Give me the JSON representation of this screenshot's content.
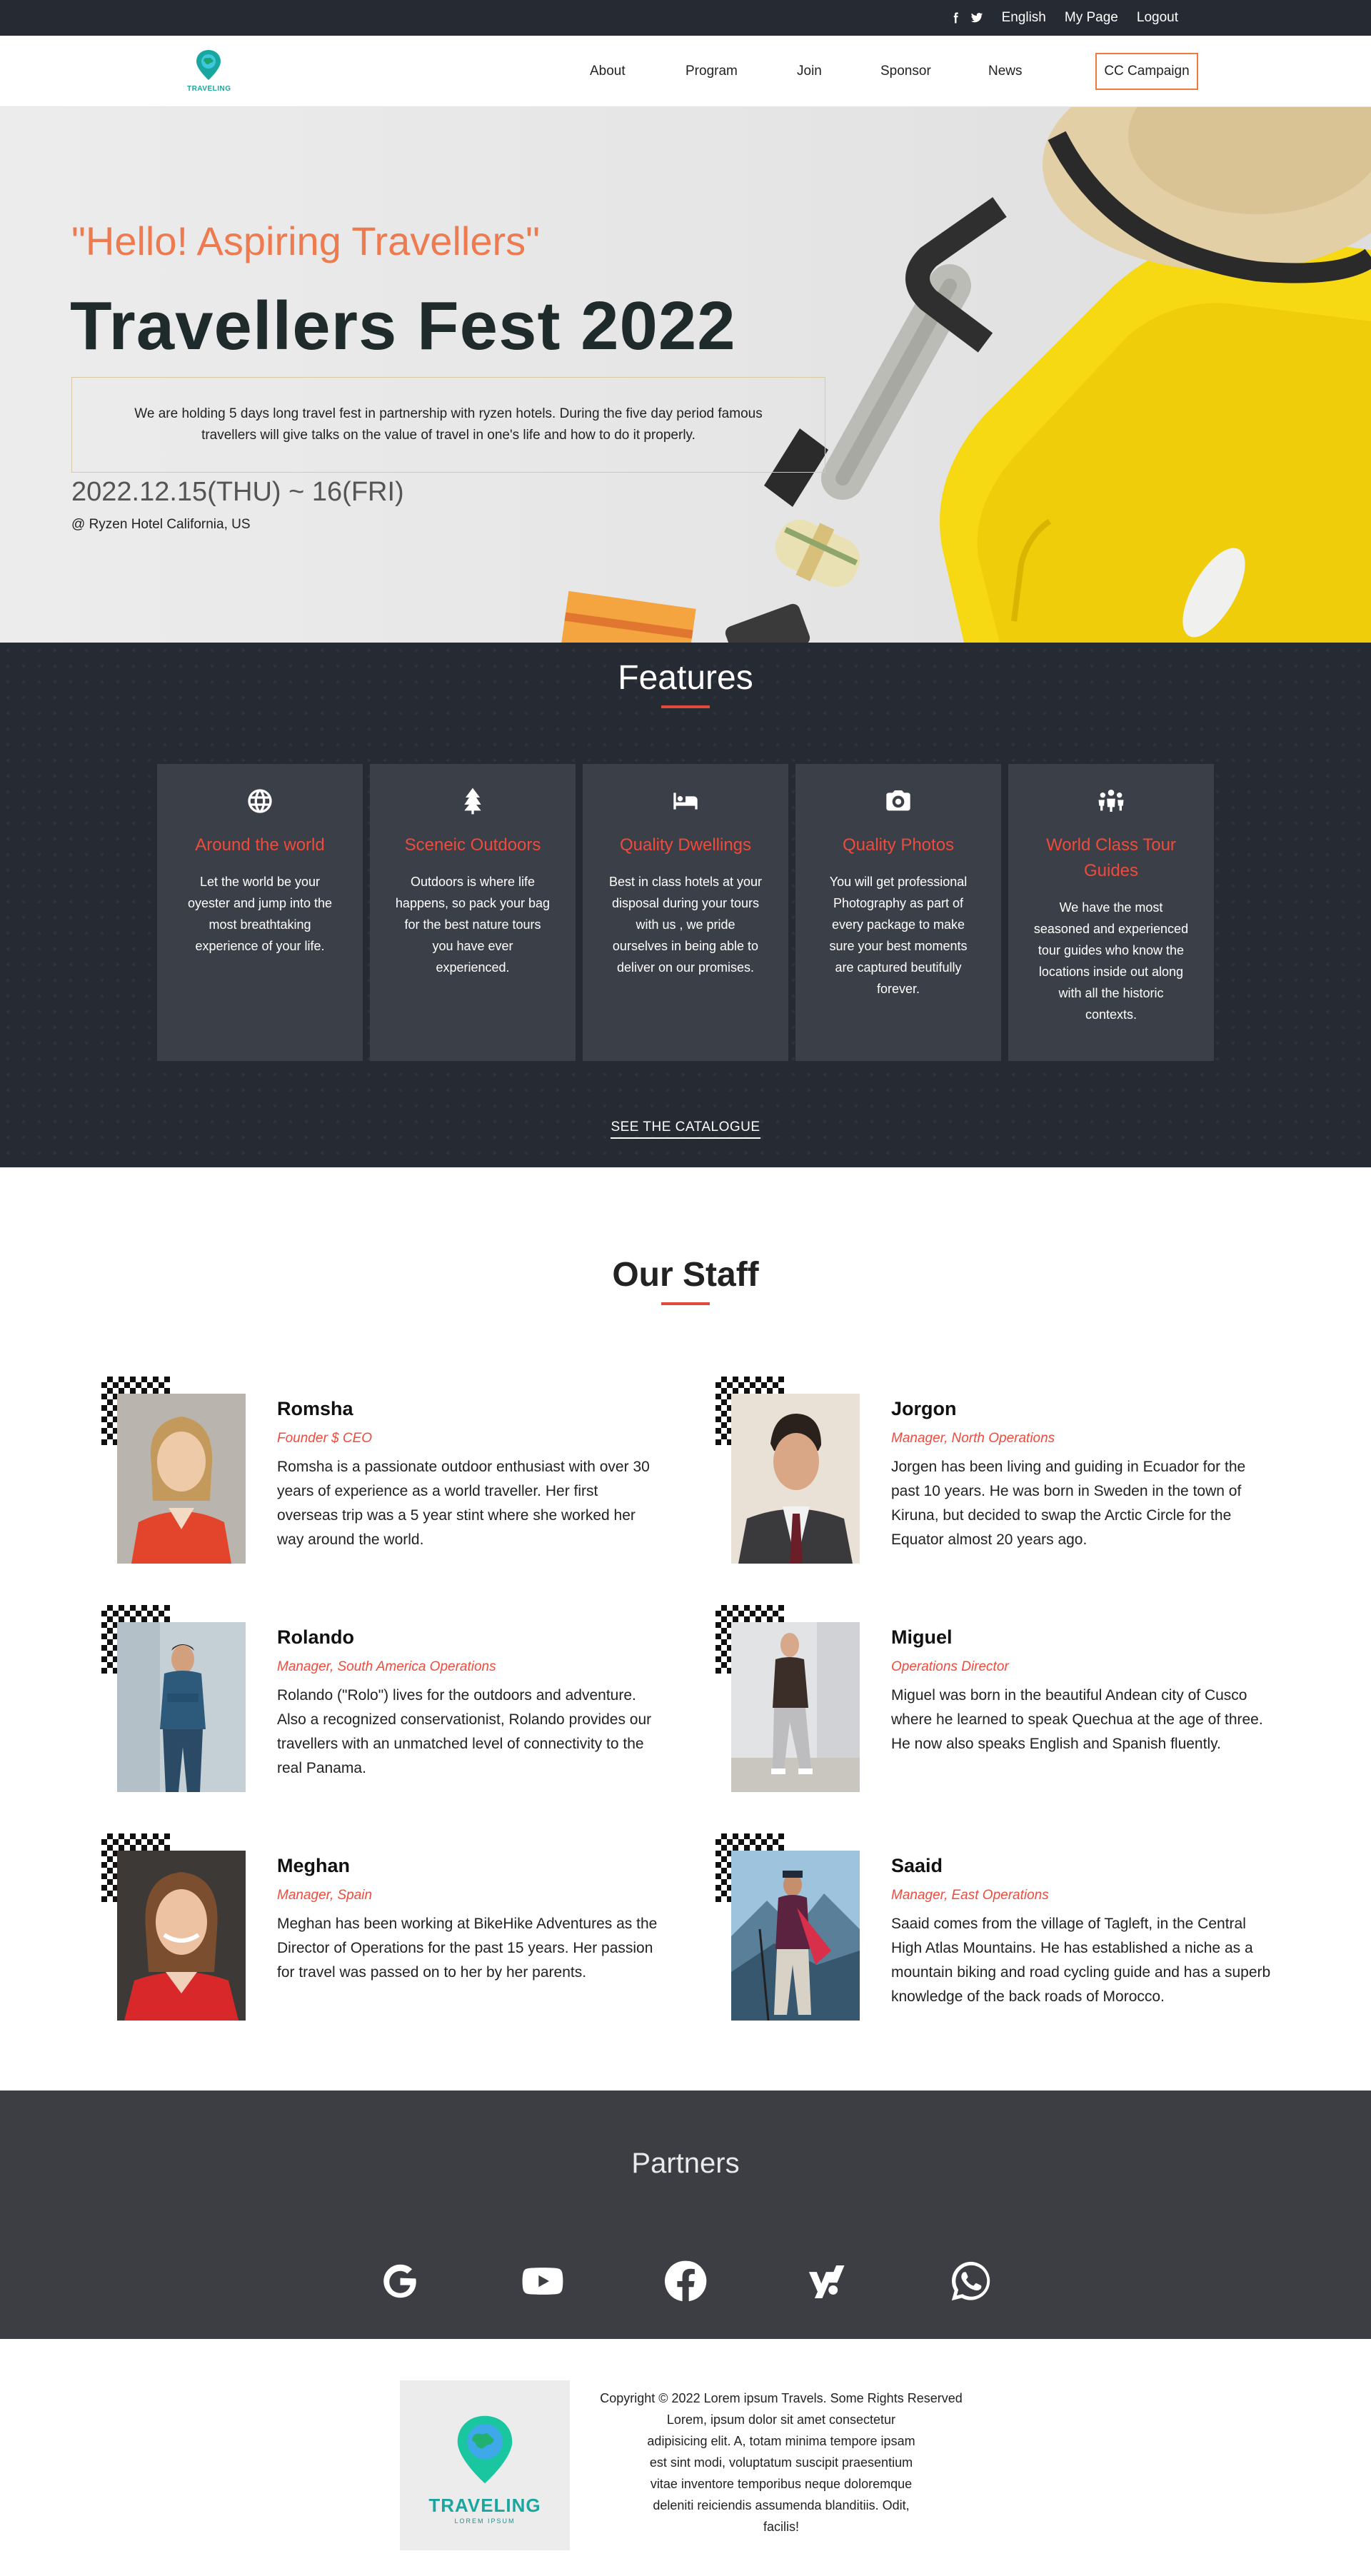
{
  "topbar": {
    "social_icons": [
      "facebook-icon",
      "twitter-icon"
    ],
    "language": "English",
    "my_page": "My Page",
    "logout": "Logout"
  },
  "nav": {
    "logo_word": "TRAVELING",
    "items": [
      "About",
      "Program",
      "Join",
      "Sponsor",
      "News"
    ],
    "cta": "CC Campaign"
  },
  "hero": {
    "subtitle": "\"Hello! Aspiring Travellers\"",
    "title": "Travellers Fest 2022",
    "description": "We are holding 5 days long travel fest in partnership with ryzen hotels. During the five day period famous travellers will give talks on the value of travel in one's life and how to do it properly.",
    "date": "2022.12.15(THU) ~ 16(FRI)",
    "venue": "@ Ryzen Hotel California, US"
  },
  "features": {
    "title": "Features",
    "cards": [
      {
        "icon": "globe-icon",
        "title": "Around the world",
        "text": "Let the world be your oyester and jump into the most breathtaking experience of your life."
      },
      {
        "icon": "tree-icon",
        "title": "Sceneic Outdoors",
        "text": "Outdoors is where life happens, so pack your bag for the best nature tours you have ever experienced."
      },
      {
        "icon": "bed-icon",
        "title": "Quality Dwellings",
        "text": "Best in class hotels at your disposal during your tours with us , we pride ourselves in being able to deliver on our promises."
      },
      {
        "icon": "camera-icon",
        "title": "Quality Photos",
        "text": "You will get professional Photography as part of every package to make sure your best moments are captured beutifully forever."
      },
      {
        "icon": "people-icon",
        "title": "World Class Tour Guides",
        "text": "We have the most seasoned and experienced tour guides who know the locations inside out along with all the historic contexts."
      }
    ],
    "catalogue_link": "SEE THE CATALOGUE"
  },
  "staff": {
    "title": "Our Staff",
    "members": [
      {
        "name": "Romsha",
        "role": "Founder $ CEO",
        "bio": "Romsha is a passionate outdoor enthusiast with over 30 years of experience as a world traveller. Her first overseas trip was a 5 year stint where she worked her way around the world."
      },
      {
        "name": "Jorgon",
        "role": "Manager, North Operations",
        "bio": "Jorgen has been living and guiding in Ecuador for the past 10 years. He was born in Sweden in the town of Kiruna, but decided to swap the Arctic Circle for the Equator almost 20 years ago."
      },
      {
        "name": "Rolando",
        "role": "Manager, South America Operations",
        "bio": "Rolando (\"Rolo\") lives for the outdoors and adventure. Also a recognized conservationist, Rolando provides our travellers with an unmatched level of connectivity to the real Panama."
      },
      {
        "name": "Miguel",
        "role": "Operations Director",
        "bio": "Miguel was born in the beautiful Andean city of Cusco where he learned to speak Quechua at the age of three. He now also speaks English and Spanish fluently."
      },
      {
        "name": "Meghan",
        "role": "Manager, Spain",
        "bio": "Meghan has been working at BikeHike Adventures as the Director of Operations for the past 15 years. Her passion for travel was passed on to her by her parents."
      },
      {
        "name": "Saaid",
        "role": "Manager, East Operations",
        "bio": "Saaid comes from the village of Tagleft, in the Central High Atlas Mountains. He has established a niche as a mountain biking and road cycling guide and has a superb knowledge of the back roads of Morocco."
      }
    ]
  },
  "partners": {
    "title": "Partners",
    "logos": [
      "google-icon",
      "youtube-icon",
      "facebook-icon",
      "yahoo-icon",
      "whatsapp-icon"
    ]
  },
  "footer": {
    "logo_word": "TRAVELING",
    "logo_tagline": "LOREM IPSUM",
    "copyright": "Copyright © 2022 Lorem ipsum Travels. Some Rights Reserved",
    "lorem": "Lorem, ipsum dolor sit amet consectetur adipisicing elit. A, totam minima tempore ipsam est sint modi, voluptatum suscipit praesentium vitae inventore temporibus neque doloremque deleniti reiciendis assumenda blanditiis. Odit, facilis!"
  },
  "colors": {
    "accent_orange": "#ee7a4f",
    "accent_red": "#ef4b3c",
    "dark_bg": "#262a33",
    "card_bg": "#3b3f47",
    "partners_bg": "#3c3e43",
    "brand_teal": "#1aa6a0",
    "hero_yellow": "#f6d813"
  }
}
